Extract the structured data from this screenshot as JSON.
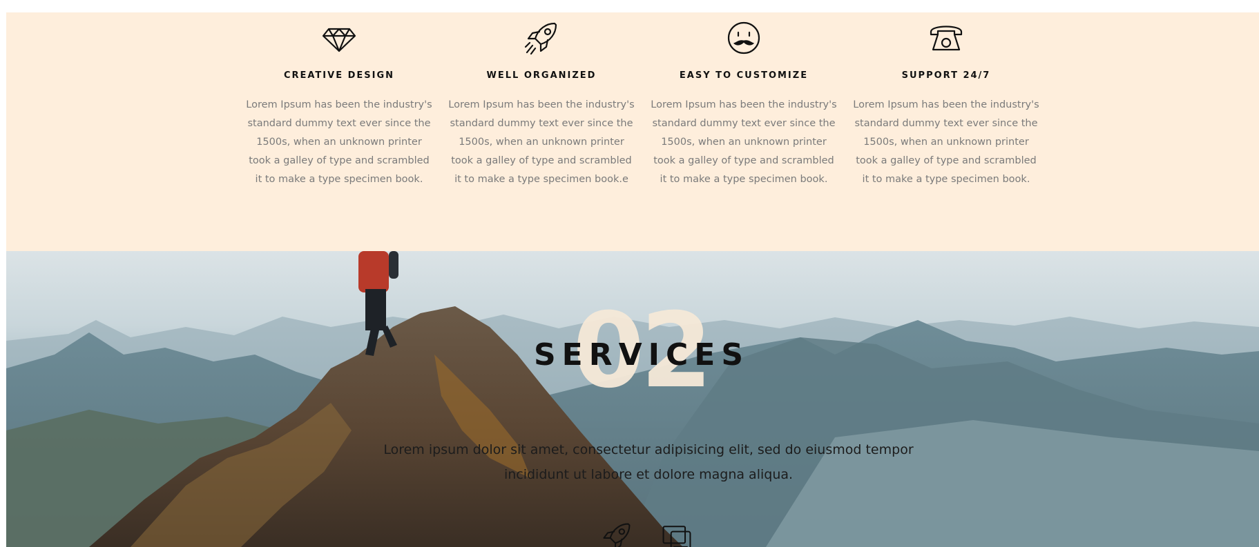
{
  "features": [
    {
      "icon": "diamond-icon",
      "title": "CREATIVE DESIGN",
      "text": "Lorem Ipsum has been the industry's standard dummy text ever since the 1500s, when an unknown printer took a galley of type and scrambled it to make a type specimen book."
    },
    {
      "icon": "rocket-icon",
      "title": "WELL ORGANIZED",
      "text": "Lorem Ipsum has been the industry's standard dummy text ever since the 1500s, when an unknown printer took a galley of type and scrambled it to make a type specimen book.e"
    },
    {
      "icon": "mustache-face-icon",
      "title": "EASY TO CUSTOMIZE",
      "text": "Lorem Ipsum has been the industry's standard dummy text ever since the 1500s, when an unknown printer took a galley of type and scrambled it to make a type specimen book."
    },
    {
      "icon": "telephone-icon",
      "title": "SUPPORT 24/7",
      "text": "Lorem Ipsum has been the industry's standard dummy text ever since the 1500s, when an unknown printer took a galley of type and scrambled it to make a type specimen book."
    }
  ],
  "services": {
    "number": "02",
    "title": "SERVICES",
    "description": "Lorem ipsum dolor sit amet, consectetur adipisicing elit, sed do eiusmod tempor incididunt ut labore et dolore magna aliqua.",
    "icons": [
      "rocket-icon",
      "devices-icon"
    ]
  },
  "colors": {
    "feature_bg": "#feeedc",
    "number": "#f6e9d8",
    "body_text": "#7a7a7a"
  }
}
